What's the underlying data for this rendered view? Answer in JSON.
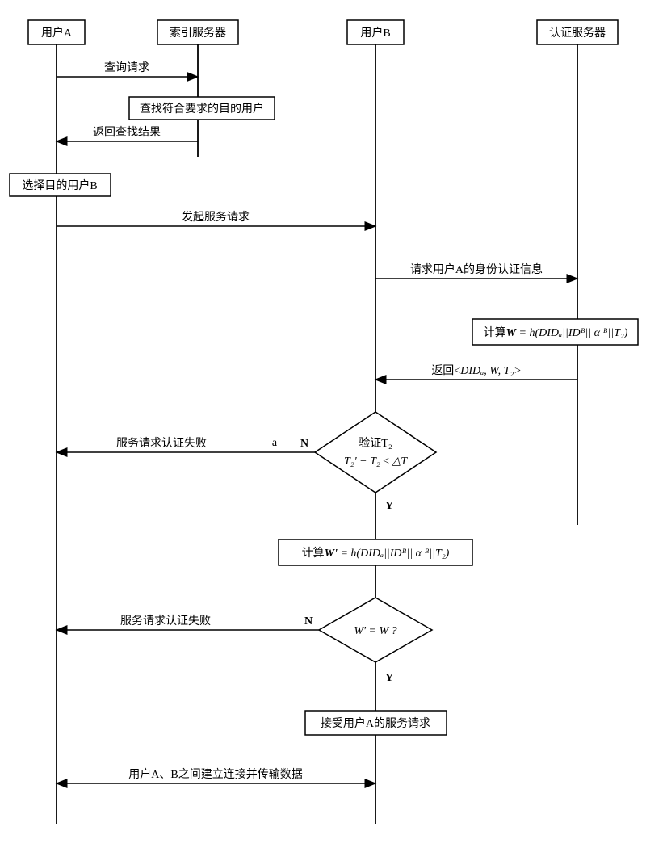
{
  "actors": {
    "userA": "用户A",
    "index": "索引服务器",
    "userB": "用户B",
    "auth": "认证服务器"
  },
  "messages": {
    "m1": "查询请求",
    "m2": "查找符合要求的目的用户",
    "m3": "返回查找结果",
    "m4": "选择目的用户B",
    "m5": "发起服务请求",
    "m6": "请求用户A的身份认证信息",
    "m7_prefix": "计算",
    "m7_var": "W",
    "m7_expr": " = h(DIDₐ||IDᴮ|| α ᴮ||T₂)",
    "m8_prefix": "返回<",
    "m8_var": "DIDₐ",
    "m8_mid": ", W, T₂>",
    "d1a": "验证T₂",
    "d1b": "T₂' − T₂ ≤ △T",
    "m9": "服务请求认证失败",
    "m9a": "a",
    "y": "Y",
    "n": "N",
    "m10_prefix": "计算",
    "m10_var": "W'",
    "m10_expr": " = h(DIDₐ||IDᴮ|| α ᴮ||T₂)",
    "d2": "W' = W ?",
    "m11": "服务请求认证失败",
    "m12": "接受用户A的服务请求",
    "m13": "用户A、B之间建立连接并传输数据"
  },
  "chart_data": {
    "type": "sequence-diagram",
    "participants": [
      "用户A",
      "索引服务器",
      "用户B",
      "认证服务器"
    ],
    "steps": [
      {
        "from": "用户A",
        "to": "索引服务器",
        "label": "查询请求"
      },
      {
        "at": "索引服务器",
        "action": "查找符合要求的目的用户"
      },
      {
        "from": "索引服务器",
        "to": "用户A",
        "label": "返回查找结果"
      },
      {
        "at": "用户A",
        "action": "选择目的用户B"
      },
      {
        "from": "用户A",
        "to": "用户B",
        "label": "发起服务请求"
      },
      {
        "from": "用户B",
        "to": "认证服务器",
        "label": "请求用户A的身份认证信息"
      },
      {
        "at": "认证服务器",
        "action": "计算W = h(DIDₐ||IDᴮ||αᴮ||T₂)"
      },
      {
        "from": "认证服务器",
        "to": "用户B",
        "label": "返回<DIDₐ, W, T₂>"
      },
      {
        "at": "用户B",
        "decision": "验证T₂  T₂'−T₂ ≤ △T",
        "no": "服务请求认证失败 → 用户A"
      },
      {
        "at": "用户B",
        "action": "计算W' = h(DIDₐ||IDᴮ||αᴮ||T₂)"
      },
      {
        "at": "用户B",
        "decision": "W' = W ?",
        "no": "服务请求认证失败 → 用户A"
      },
      {
        "at": "用户B",
        "action": "接受用户A的服务请求"
      },
      {
        "between": [
          "用户A",
          "用户B"
        ],
        "label": "用户A、B之间建立连接并传输数据"
      }
    ]
  }
}
